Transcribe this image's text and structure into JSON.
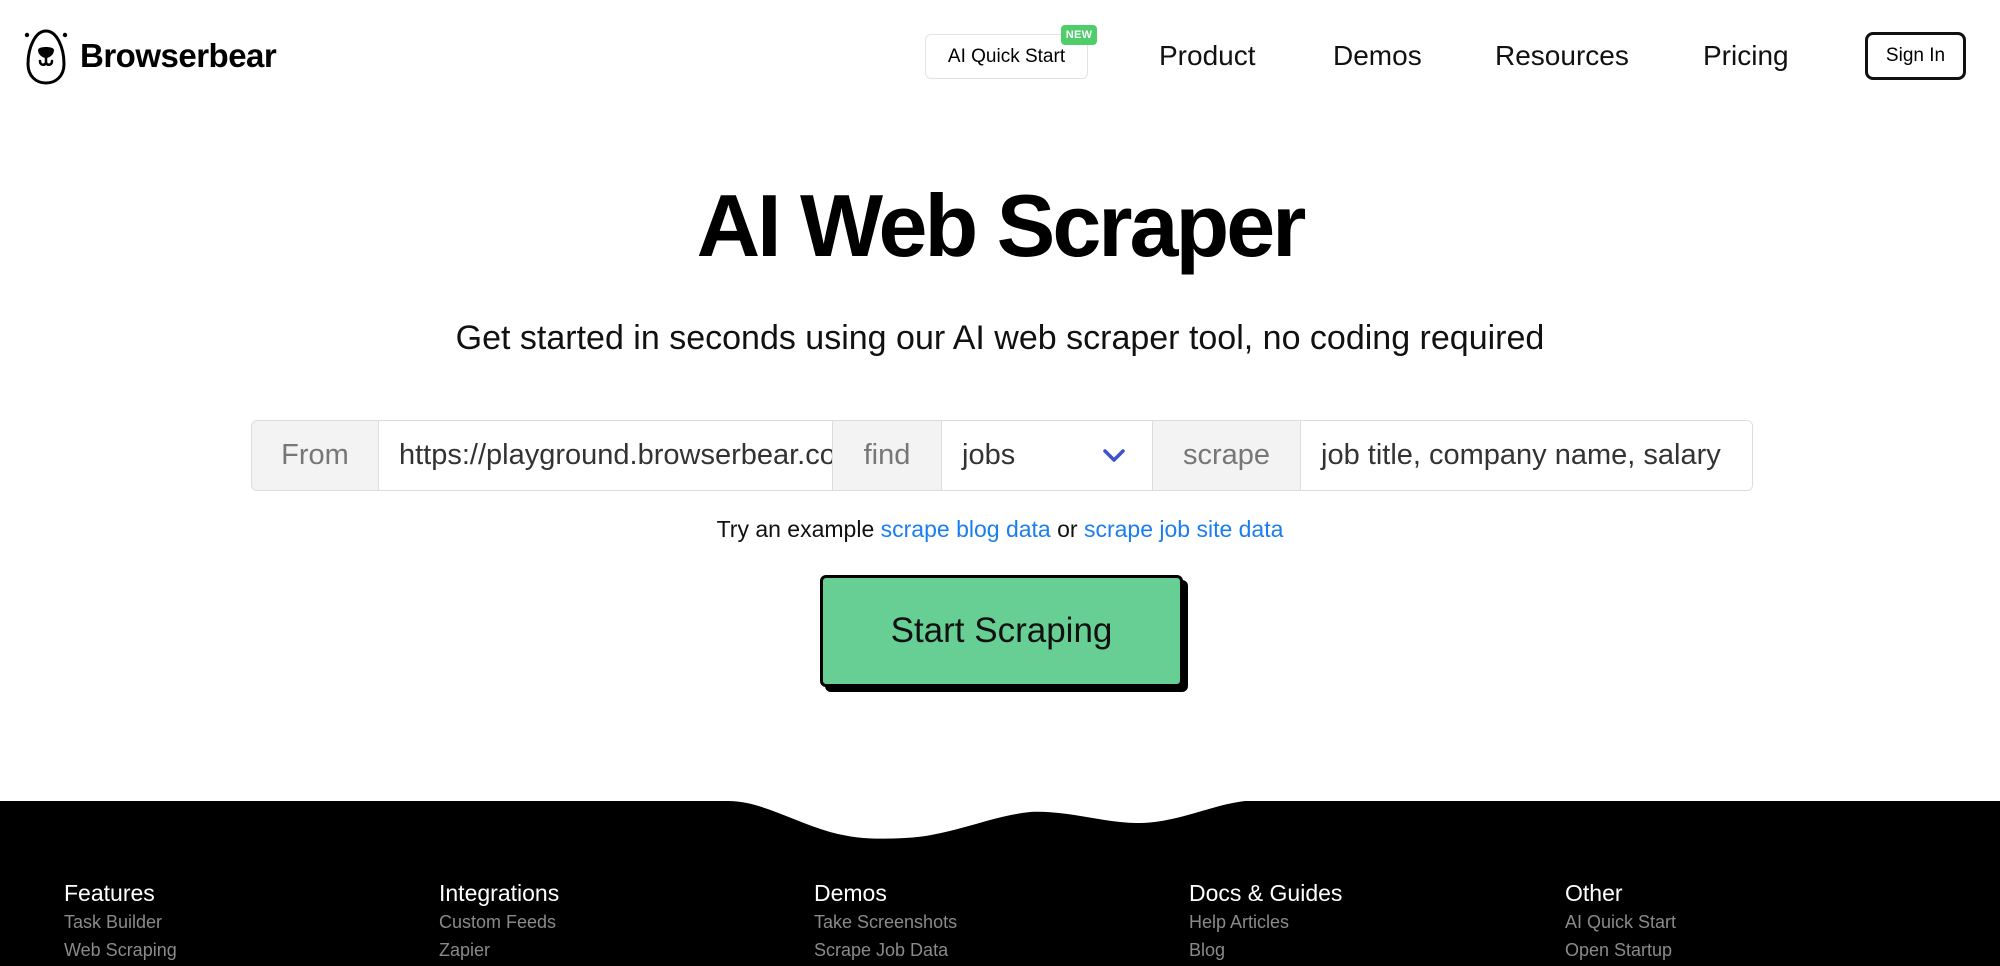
{
  "header": {
    "brand": "Browserbear",
    "quick_start": "AI Quick Start",
    "new_badge": "NEW",
    "nav": [
      "Product",
      "Demos",
      "Resources",
      "Pricing"
    ],
    "sign_in": "Sign In"
  },
  "hero": {
    "title": "AI Web Scraper",
    "subtitle": "Get started in seconds using our AI web scraper tool, no coding required"
  },
  "form": {
    "from_label": "From",
    "url_value": "https://playground.browserbear.com/jobs/",
    "find_label": "find",
    "find_selected": "jobs",
    "scrape_label": "scrape",
    "fields_value": "job title, company name, salary"
  },
  "examples": {
    "prefix": "Try an example",
    "link1": "scrape blog data",
    "middle": "or",
    "link2": "scrape job site data"
  },
  "cta": {
    "label": "Start Scraping"
  },
  "colors": {
    "cta_green": "#68cf94",
    "link_blue": "#1a7ef0",
    "badge_green": "#4fcd6a",
    "chevron_blue": "#3f51cf"
  },
  "footer": {
    "columns": [
      {
        "heading": "Features",
        "links": [
          "Task Builder",
          "Web Scraping"
        ]
      },
      {
        "heading": "Integrations",
        "links": [
          "Custom Feeds",
          "Zapier"
        ]
      },
      {
        "heading": "Demos",
        "links": [
          "Take Screenshots",
          "Scrape Job Data"
        ]
      },
      {
        "heading": "Docs & Guides",
        "links": [
          "Help Articles",
          "Blog"
        ]
      },
      {
        "heading": "Other",
        "links": [
          "AI Quick Start",
          "Open Startup"
        ]
      }
    ]
  }
}
